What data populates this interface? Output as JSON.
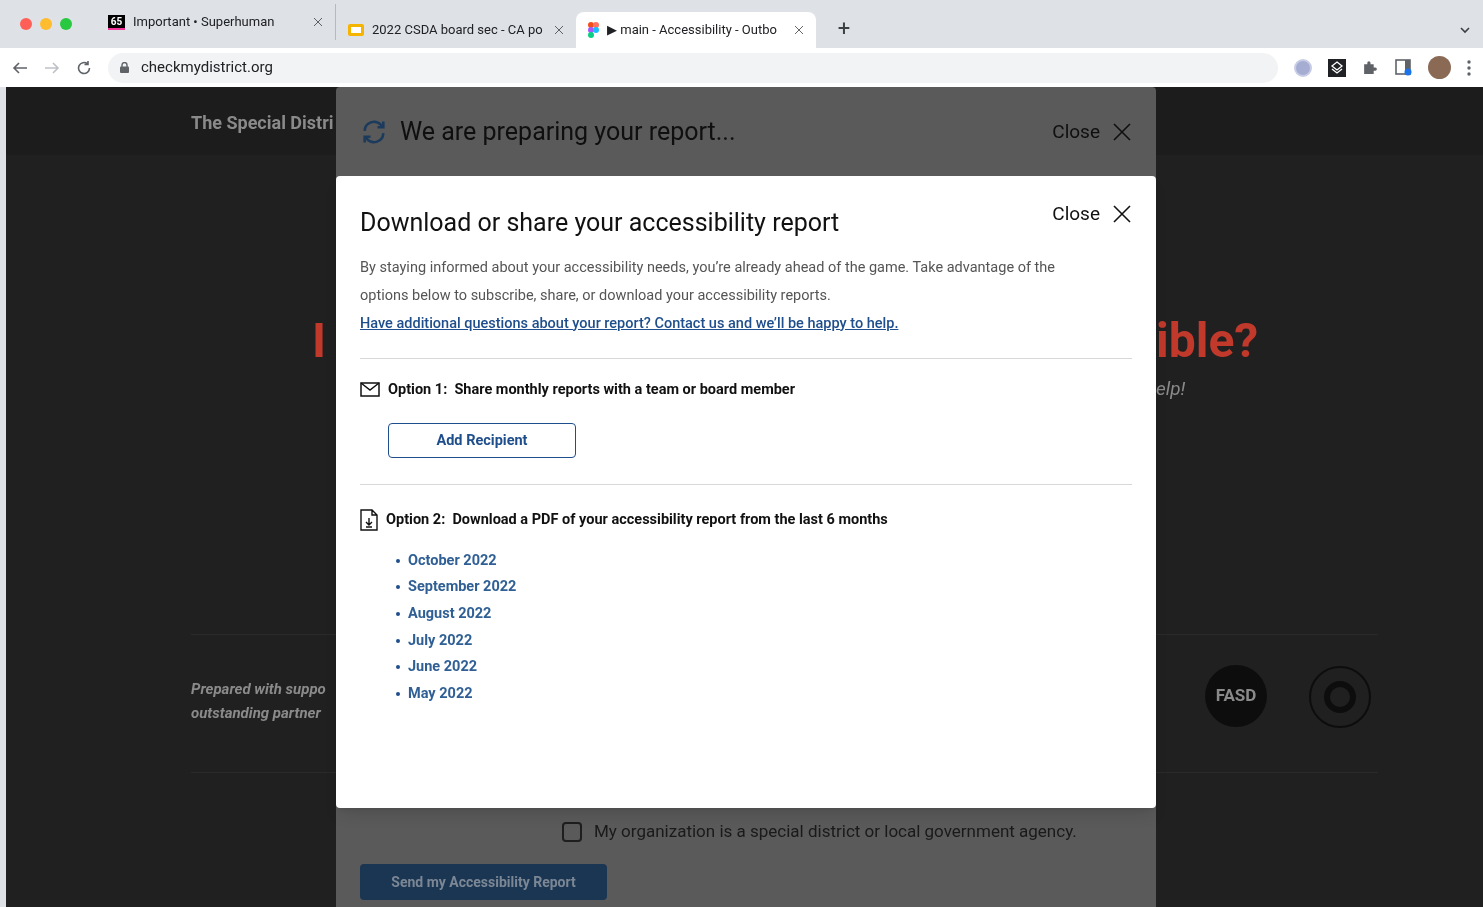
{
  "browser": {
    "tabs": [
      {
        "badge": "65",
        "title": "Important • Superhuman",
        "selected": false
      },
      {
        "title": "2022 CSDA board sec - CA po",
        "selected": false
      },
      {
        "title": "▶ main - Accessibility - Outbo",
        "selected": true
      }
    ],
    "new_tab": "+",
    "url": "checkmydistrict.org"
  },
  "background_page": {
    "header": "The Special Distri",
    "headline_left": "I",
    "headline_right": "ible?",
    "subhead_right": "elp!",
    "partners_text": [
      "Prepared with suppo",
      "outstanding partner"
    ],
    "partner_logo": "FASD"
  },
  "underlying_dialog": {
    "title": "We are preparing your report...",
    "close": "Close",
    "checkbox": {
      "label": "My organization is a special district or local government agency.",
      "checked": false
    },
    "submit": "Send my Accessibility Report"
  },
  "dialog": {
    "title": "Download or share your accessibility report",
    "close": "Close",
    "intro": "By staying informed about your accessibility needs, you’re already ahead of the game. Take advantage of the options below to subscribe, share, or download your accessibility reports.",
    "help_link": "Have additional questions about your report? Contact us and we’ll be happy to help.",
    "option1": {
      "label": "Option 1:",
      "text": "Share monthly reports with a team or board member",
      "button": "Add Recipient"
    },
    "option2": {
      "label": "Option 2:",
      "text": "Download a PDF of your accessibility report from the last 6 months",
      "months": [
        "October 2022",
        "September 2022",
        "August 2022",
        "July 2022",
        "June 2022",
        "May 2022"
      ]
    }
  }
}
